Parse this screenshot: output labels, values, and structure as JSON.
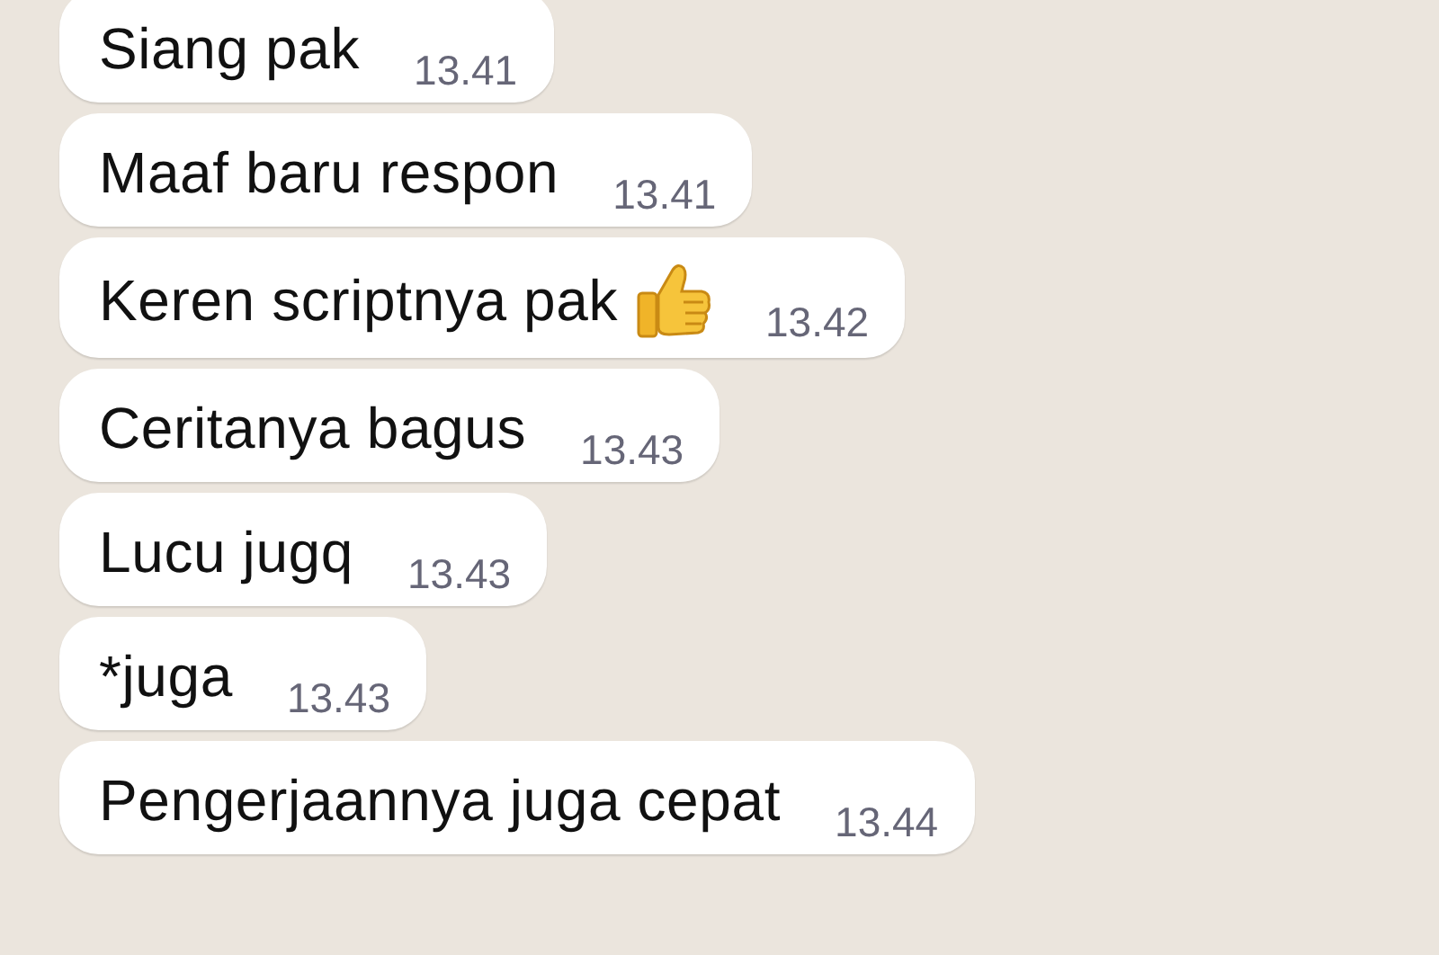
{
  "messages": [
    {
      "text": "Siang pak",
      "time": "13.41",
      "emoji": false
    },
    {
      "text": "Maaf baru respon",
      "time": "13.41",
      "emoji": false
    },
    {
      "text": "Keren scriptnya pak",
      "time": "13.42",
      "emoji": true
    },
    {
      "text": "Ceritanya bagus",
      "time": "13.43",
      "emoji": false
    },
    {
      "text": "Lucu jugq",
      "time": "13.43",
      "emoji": false
    },
    {
      "text": "*juga",
      "time": "13.43",
      "emoji": false
    },
    {
      "text": "Pengerjaannya juga cepat",
      "time": "13.44",
      "emoji": false
    }
  ]
}
